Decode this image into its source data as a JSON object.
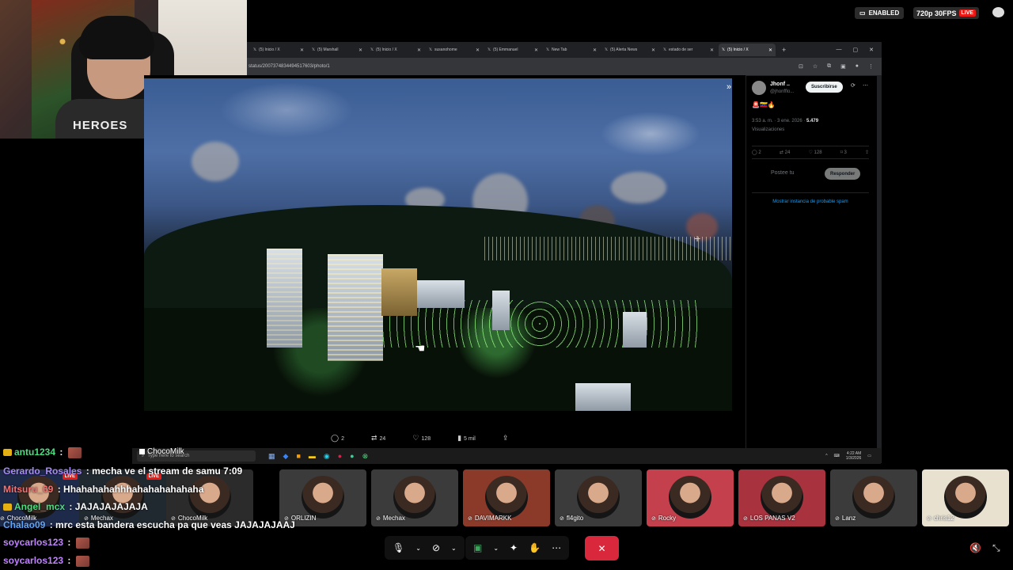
{
  "stream_status": {
    "enabled_label": "ENABLED",
    "resolution": "720p 30FPS",
    "live": "LIVE"
  },
  "webcam": {
    "shirt_text": "HEROES"
  },
  "browser": {
    "tabs": [
      {
        "label": "(5) Inicio / X",
        "active": false
      },
      {
        "label": "(5) Marshall",
        "active": false
      },
      {
        "label": "(5) Inicio / X",
        "active": false
      },
      {
        "label": "susanohome",
        "active": false
      },
      {
        "label": "(5) Emmanuel",
        "active": false
      },
      {
        "label": "New Tab",
        "active": false
      },
      {
        "label": "(5) Alerta News",
        "active": false
      },
      {
        "label": "estado de ser",
        "active": false
      },
      {
        "label": "(5) Inicio / X",
        "active": true
      }
    ],
    "url": "status/2007374834494517603/photo/1"
  },
  "photo_actions": {
    "replies": "2",
    "reposts": "24",
    "likes": "128",
    "views": "5 mil"
  },
  "tweet": {
    "name": "Jhonf ..",
    "handle": "@jhonfflo...",
    "subscribe": "Suscribirse",
    "emoji": "🚨🇻🇪🔥",
    "time": "3:53 a. m. · 3 ene. 2026 · ",
    "views_count": "5.479",
    "views_label": "Visualizaciones",
    "stats": {
      "replies": "2",
      "reposts": "24",
      "likes": "128",
      "bookmarks": "3"
    },
    "reply_placeholder": "Postee tu",
    "reply_button": "Responder",
    "spam_link": "Mostrar instancia de probable spam"
  },
  "taskbar": {
    "search_placeholder": "Type here to search",
    "time": "4:22 AM",
    "date": "1/3/2026"
  },
  "chat": [
    {
      "user": "antu1234",
      "color": "#4ade80",
      "msg": "",
      "emote": true
    },
    {
      "user": "Gerardo_Rosales",
      "color": "#a78bfa",
      "msg": "mecha ve el stream de samu 7:09",
      "emote": false
    },
    {
      "user": "Mitsuru_69",
      "color": "#f87171",
      "msg": "Hhahahahahhhahahahahahaha",
      "emote": false
    },
    {
      "user": "Angel_mcx",
      "color": "#4ade80",
      "msg": "JAJAJAJAJAJA",
      "emote": false
    },
    {
      "user": "Chalao09",
      "color": "#60a5fa",
      "msg": "mrc esta bandera escucha pa que veas JAJAJAJAAJ",
      "emote": false
    },
    {
      "user": "soycarlos123",
      "color": "#c084fc",
      "msg": "",
      "emote": true
    },
    {
      "user": "soycarlos123",
      "color": "#c084fc",
      "msg": "",
      "emote": true
    }
  ],
  "participants": [
    {
      "name": "ChocoMilk",
      "live": true,
      "color": "#1e2a4a"
    },
    {
      "name": "Mechax",
      "live": true,
      "color": "#202830"
    },
    {
      "name": "ChocoMilk",
      "live": false,
      "color": "#2b2b2b"
    },
    {
      "name": "ORLIZIN",
      "live": false,
      "color": "#3b3b3b"
    },
    {
      "name": "Mechax",
      "live": false,
      "color": "#3b3b3b"
    },
    {
      "name": "DAVIMARKK",
      "live": false,
      "color": "#8b3a2a"
    },
    {
      "name": "fl4gito",
      "live": false,
      "color": "#3b3b3b"
    },
    {
      "name": "Rocky",
      "live": false,
      "color": "#c4404c"
    },
    {
      "name": "LOS PANAS V2",
      "live": false,
      "color": "#a8323e"
    },
    {
      "name": "Lanz",
      "live": false,
      "color": "#3b3b3b"
    },
    {
      "name": "chris12",
      "live": false,
      "color": "#e8e1d0"
    }
  ],
  "chocomilk_label": "ChocoMilk"
}
